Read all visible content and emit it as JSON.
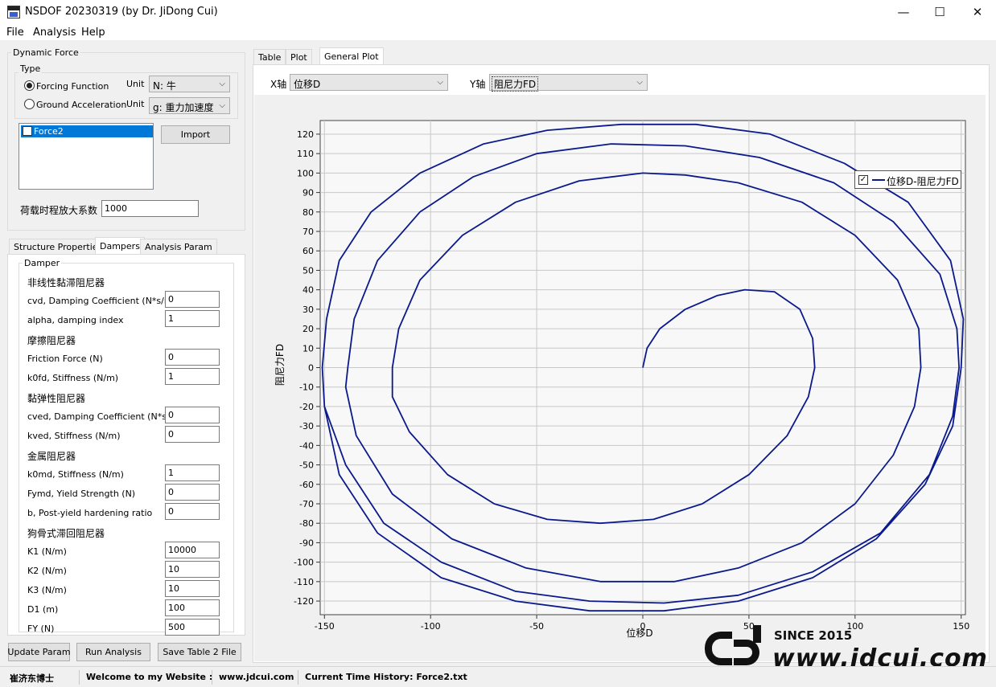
{
  "window": {
    "title": "NSDOF 20230319 (by Dr. JiDong Cui)",
    "minimize": "—",
    "maximize": "☐",
    "close": "✕"
  },
  "menu": [
    "File",
    "Analysis",
    "Help"
  ],
  "dynamic_force": {
    "group_title": "Dynamic Force",
    "type_title": "Type",
    "forcing_label": "Forcing Function",
    "ground_label": "Ground Acceleration",
    "unit_label": "Unit",
    "forcing_unit": "N: 牛",
    "ground_unit": "g: 重力加速度",
    "selected_type": "Forcing Function",
    "list_items": [
      {
        "label": "Force2",
        "checked": false,
        "selected": true
      }
    ],
    "import_button": "Import",
    "amp_label": "荷载时程放大系数",
    "amp_value": "1000"
  },
  "left_tabs": [
    "Structure Properties",
    "Dampers",
    "Analysis Param"
  ],
  "active_left_tab": "Dampers",
  "damper": {
    "group_title": "Damper",
    "sections": [
      {
        "title": "非线性黏滞阻尼器",
        "fields": [
          {
            "label": "cvd, Damping Coefficient (N*s/m)",
            "value": "0"
          },
          {
            "label": "alpha, damping index",
            "value": "1"
          }
        ]
      },
      {
        "title": "摩擦阻尼器",
        "fields": [
          {
            "label": "Friction Force (N)",
            "value": "0"
          },
          {
            "label": "k0fd, Stiffness (N/m)",
            "value": "1"
          }
        ]
      },
      {
        "title": "黏弹性阻尼器",
        "fields": [
          {
            "label": "cved, Damping Coefficient (N*s/m)",
            "value": "0"
          },
          {
            "label": "kved, Stiffness (N/m)",
            "value": "0"
          }
        ]
      },
      {
        "title": "金属阻尼器",
        "fields": [
          {
            "label": "k0md, Stiffness (N/m)",
            "value": "1"
          },
          {
            "label": "Fymd, Yield Strength (N)",
            "value": "0"
          },
          {
            "label": "b, Post-yield hardening ratio",
            "value": "0"
          }
        ]
      },
      {
        "title": "狗骨式滞回阻尼器",
        "fields": [
          {
            "label": "K1  (N/m)",
            "value": "10000"
          },
          {
            "label": "K2  (N/m)",
            "value": "10"
          },
          {
            "label": "K3  (N/m)",
            "value": "10"
          },
          {
            "label": "D1  (m)",
            "value": "100"
          },
          {
            "label": "FY  (N)",
            "value": "500"
          }
        ]
      }
    ]
  },
  "bottom_buttons": [
    "Update Param",
    "Run Analysis",
    "Save Table 2 File"
  ],
  "right_tabs": [
    "Table",
    "Plot",
    "General Plot"
  ],
  "active_right_tab": "General Plot",
  "x_axis_label": "X轴",
  "x_axis_value": "位移D",
  "y_axis_label": "Y轴",
  "y_axis_value": "阻尼力FD",
  "chart_data": {
    "type": "line",
    "xlabel": "位移D",
    "ylabel": "阻尼力FD",
    "xlim": [
      -152,
      152
    ],
    "ylim": [
      -127,
      127
    ],
    "xticks": [
      -150,
      -100,
      -50,
      0,
      50,
      100,
      150
    ],
    "yticks": [
      -120,
      -110,
      -100,
      -90,
      -80,
      -70,
      -60,
      -50,
      -40,
      -30,
      -20,
      -10,
      0,
      10,
      20,
      30,
      40,
      50,
      60,
      70,
      80,
      90,
      100,
      110,
      120
    ],
    "grid": true,
    "legend": {
      "position": "top-right",
      "checked": true
    },
    "series": [
      {
        "name": "位移D-阻尼力FD",
        "color": "#0a1a8c",
        "x": [
          0,
          2,
          8,
          20,
          35,
          48,
          62,
          74,
          80,
          81,
          78,
          68,
          50,
          28,
          5,
          -20,
          -45,
          -70,
          -92,
          -110,
          -118,
          -118,
          -115,
          -105,
          -85,
          -60,
          -30,
          0,
          20,
          45,
          75,
          100,
          120,
          130,
          131,
          128,
          118,
          100,
          75,
          45,
          15,
          -20,
          -55,
          -90,
          -118,
          -135,
          -140,
          -139,
          -136,
          -125,
          -105,
          -80,
          -50,
          -15,
          20,
          55,
          90,
          118,
          140,
          148,
          149,
          146,
          135,
          112,
          80,
          45,
          10,
          -25,
          -60,
          -95,
          -122,
          -140,
          -150,
          -151,
          -149,
          -143,
          -128,
          -105,
          -75,
          -45,
          -10,
          25,
          60,
          95,
          125,
          145,
          151,
          150,
          146,
          133,
          110,
          80,
          45,
          10,
          -25,
          -60,
          -95,
          -125,
          -143,
          -150
        ],
        "y": [
          0,
          10,
          20,
          30,
          37,
          40,
          39,
          30,
          15,
          0,
          -15,
          -35,
          -55,
          -70,
          -78,
          -80,
          -78,
          -70,
          -55,
          -33,
          -15,
          0,
          20,
          45,
          68,
          85,
          96,
          100,
          99,
          95,
          85,
          68,
          45,
          20,
          0,
          -20,
          -45,
          -70,
          -90,
          -103,
          -110,
          -110,
          -103,
          -88,
          -65,
          -35,
          -10,
          0,
          25,
          55,
          80,
          98,
          110,
          115,
          114,
          108,
          95,
          75,
          48,
          20,
          0,
          -25,
          -55,
          -85,
          -105,
          -117,
          -121,
          -120,
          -115,
          -100,
          -80,
          -50,
          -20,
          0,
          25,
          55,
          80,
          100,
          115,
          122,
          125,
          125,
          120,
          105,
          85,
          55,
          25,
          0,
          -30,
          -60,
          -88,
          -108,
          -120,
          -125,
          -125,
          -120,
          -108,
          -85,
          -55,
          -20
        ]
      }
    ]
  },
  "watermark": {
    "since": "SINCE 2015",
    "site": "www.jdcui.com"
  },
  "status": [
    "崔济东博士",
    "Welcome to my Website :",
    "www.jdcui.com",
    "Current Time History: Force2.txt"
  ]
}
